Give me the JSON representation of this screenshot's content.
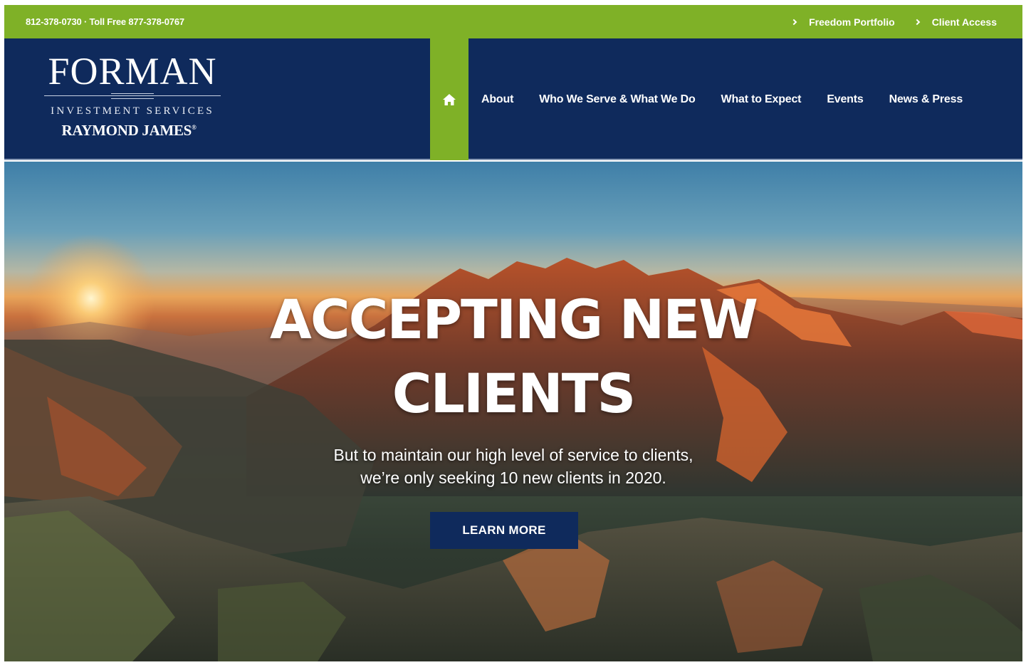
{
  "topbar": {
    "phones": "812-378-0730 · Toll Free 877-378-0767",
    "links": [
      {
        "label": "Freedom Portfolio"
      },
      {
        "label": "Client Access"
      }
    ]
  },
  "logo": {
    "name": "FORMAN",
    "subtitle": "INVESTMENT SERVICES",
    "partner": "RAYMOND JAMES",
    "partner_mark": "®"
  },
  "nav": {
    "home_icon": "home-icon",
    "items": [
      {
        "label": "About"
      },
      {
        "label": "Who We Serve & What We Do"
      },
      {
        "label": "What to Expect"
      },
      {
        "label": "Events"
      },
      {
        "label": "News & Press"
      }
    ]
  },
  "hero": {
    "headline": "ACCEPTING NEW CLIENTS",
    "subline_1": "But to maintain our high level of service to clients,",
    "subline_2": "we’re only seeking 10 new clients in 2020.",
    "cta_label": "LEARN MORE"
  },
  "colors": {
    "accent_green": "#7fb127",
    "navy": "#0f2a5c",
    "text_on_dark": "#ffffff"
  }
}
